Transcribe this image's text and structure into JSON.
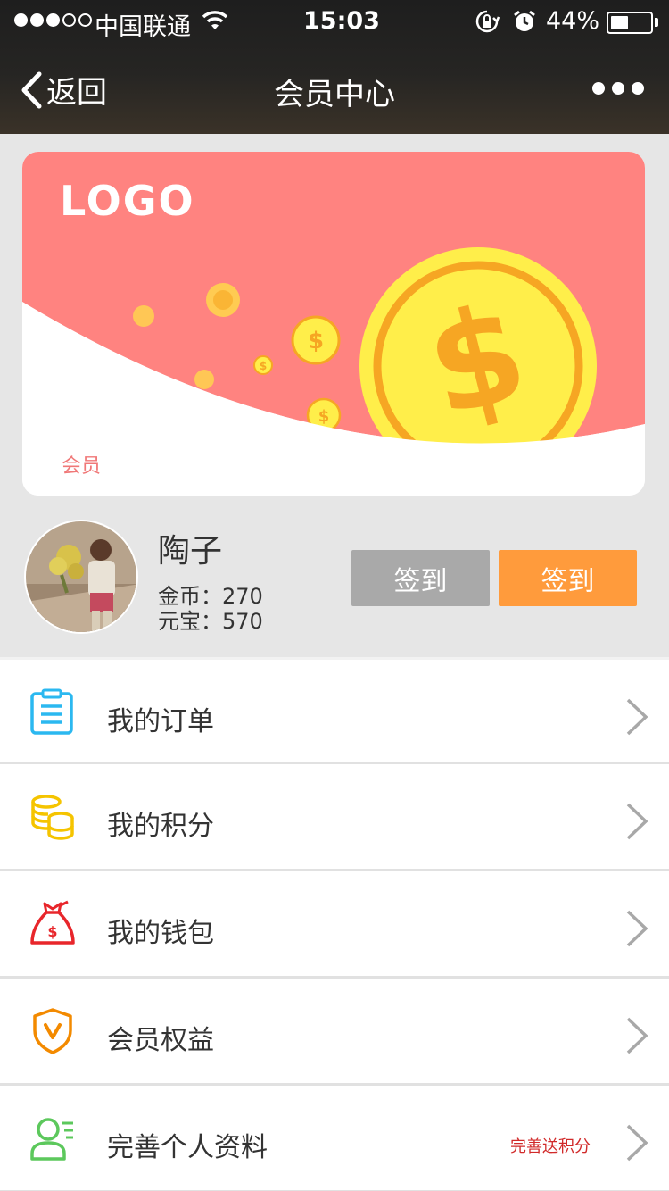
{
  "status_bar": {
    "carrier": "中国联通",
    "time": "15:03",
    "battery": "44%",
    "battery_level": 0.44
  },
  "nav": {
    "back_label": "返回",
    "title": "会员中心"
  },
  "card": {
    "logo": "LOGO",
    "label": "会员"
  },
  "user": {
    "name": "陶子",
    "coins": "金币：270",
    "ingots": "元宝：570"
  },
  "buttons": {
    "checkin_gray": "签到",
    "checkin_orange": "签到"
  },
  "menu": [
    {
      "label": "我的订单",
      "icon": "order-list-icon"
    },
    {
      "label": "我的积分",
      "icon": "points-coins-icon"
    },
    {
      "label": "我的钱包",
      "icon": "money-bag-icon"
    },
    {
      "label": "会员权益",
      "icon": "vip-shield-icon"
    },
    {
      "label": "完善个人资料",
      "icon": "user-profile-icon",
      "note": "完善送积分"
    }
  ],
  "colors": {
    "card_pink": "#ff8380",
    "coin_yellow": "#ffee4a",
    "coin_orange": "#f6a623",
    "button_gray": "#a9a9a9",
    "button_orange": "#ff9b3c",
    "note_red": "#d12a2a"
  }
}
